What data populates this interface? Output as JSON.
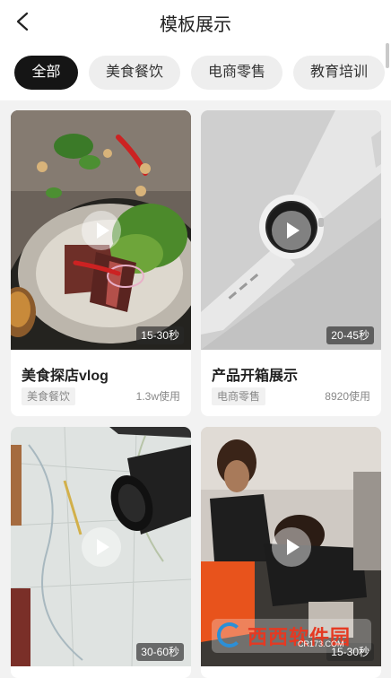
{
  "header": {
    "title": "模板展示"
  },
  "tabs": [
    {
      "label": "全部",
      "active": true
    },
    {
      "label": "美食餐饮",
      "active": false
    },
    {
      "label": "电商零售",
      "active": false
    },
    {
      "label": "教育培训",
      "active": false
    }
  ],
  "cards": [
    {
      "name": "美食探店vlog",
      "tag": "美食餐饮",
      "uses": "1.3w使用",
      "duration": "15-30秒"
    },
    {
      "name": "产品开箱展示",
      "tag": "电商零售",
      "uses": "8920使用",
      "duration": "20-45秒"
    },
    {
      "duration": "30-60秒"
    },
    {
      "duration": "15-30秒"
    }
  ],
  "watermark": {
    "name": "西西软件园",
    "url": "CR173.COM"
  },
  "colors": {
    "active_tab_bg": "#151515",
    "tab_bg": "#eeeeee",
    "page_bg": "#f2f2f2"
  }
}
